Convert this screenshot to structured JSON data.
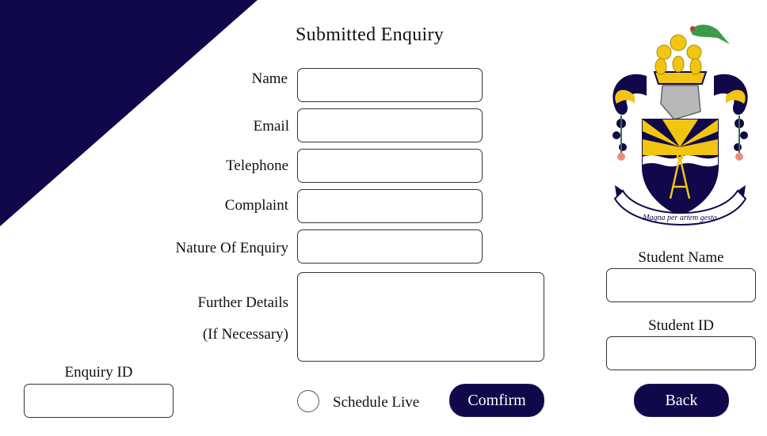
{
  "page": {
    "title": "Submitted Enquiry"
  },
  "colors": {
    "navy": "#10084b",
    "gold": "#f2c512",
    "white": "#ffffff",
    "border": "#333333"
  },
  "form": {
    "name_label": "Name",
    "email_label": "Email",
    "telephone_label": "Telephone",
    "complaint_label": "Complaint",
    "nature_label": "Nature Of Enquiry",
    "details_label_line1": "Further Details",
    "details_label_line2": "(If Necessary)",
    "name_value": "",
    "email_value": "",
    "telephone_value": "",
    "complaint_value": "",
    "nature_value": "",
    "details_value": ""
  },
  "enquiry": {
    "id_label": "Enquiry ID",
    "id_value": ""
  },
  "student": {
    "name_label": "Student Name",
    "name_value": "",
    "id_label": "Student ID",
    "id_value": ""
  },
  "actions": {
    "schedule_label": "Schedule Live",
    "schedule_checked": false,
    "confirm_label": "Comfirm",
    "back_label": "Back"
  },
  "crest": {
    "motto": "Magna per artem gesta",
    "icon": "university-crest-icon"
  }
}
